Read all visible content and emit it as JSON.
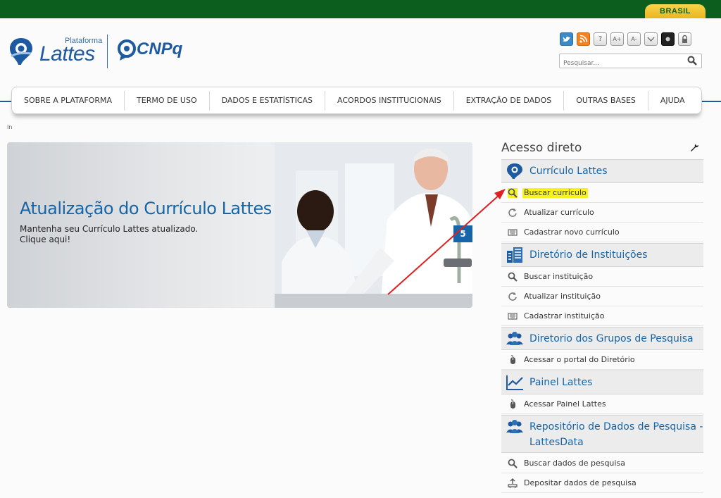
{
  "gov": {
    "brasil_label": "BRASIL"
  },
  "header": {
    "logo_plataforma": "Plataforma",
    "logo_lattes": "Lattes",
    "logo_cnpq": "CNPq"
  },
  "tools": {
    "help": "?",
    "font_up": "A+",
    "font_down": "A-",
    "search_placeholder": "Pesquisar..."
  },
  "nav": {
    "items": [
      "SOBRE A PLATAFORMA",
      "TERMO DE USO",
      "DADOS E ESTATÍSTICAS",
      "ACORDOS INSTITUCIONAIS",
      "EXTRAÇÃO DE DADOS",
      "OUTRAS BASES",
      "AJUDA"
    ]
  },
  "breadcrumb": "In",
  "banner": {
    "title": "Atualização do Currículo Lattes",
    "line1": "Mantenha seu Currículo Lattes atualizado.",
    "line2": "Clique aqui!",
    "badge": "5"
  },
  "sidebar": {
    "title": "Acesso direto",
    "sections": [
      {
        "title": "Currículo Lattes",
        "icon": "lattes-logo-icon",
        "links": [
          {
            "label": "Buscar currículo",
            "icon": "search-icon"
          },
          {
            "label": "Atualizar currículo",
            "icon": "refresh-icon"
          },
          {
            "label": "Cadastrar novo currículo",
            "icon": "keyboard-icon"
          }
        ]
      },
      {
        "title": "Diretório de Instituições",
        "icon": "building-icon",
        "links": [
          {
            "label": "Buscar instituição",
            "icon": "search-icon"
          },
          {
            "label": "Atualizar instituição",
            "icon": "refresh-icon"
          },
          {
            "label": "Cadastrar instituição",
            "icon": "keyboard-icon"
          }
        ]
      },
      {
        "title": "Diretorio dos Grupos de Pesquisa",
        "icon": "group-icon",
        "links": [
          {
            "label": "Acessar o portal do Diretório",
            "icon": "mouse-icon"
          }
        ]
      },
      {
        "title": "Painel Lattes",
        "icon": "chart-line-icon",
        "links": [
          {
            "label": "Acessar Painel Lattes",
            "icon": "mouse-icon"
          }
        ]
      },
      {
        "title_line1": "Repositório de Dados de Pesquisa -",
        "title_line2": "LattesData",
        "icon": "group-icon",
        "links": [
          {
            "label": "Buscar dados de pesquisa",
            "icon": "search-icon"
          },
          {
            "label": "Depositar dados de pesquisa",
            "icon": "upload-icon"
          }
        ]
      }
    ]
  },
  "colors": {
    "gov_green": "#0b5e1d",
    "brand_blue": "#1565a8",
    "highlight": "#f6f31a",
    "annotation_arrow": "#e02020"
  }
}
